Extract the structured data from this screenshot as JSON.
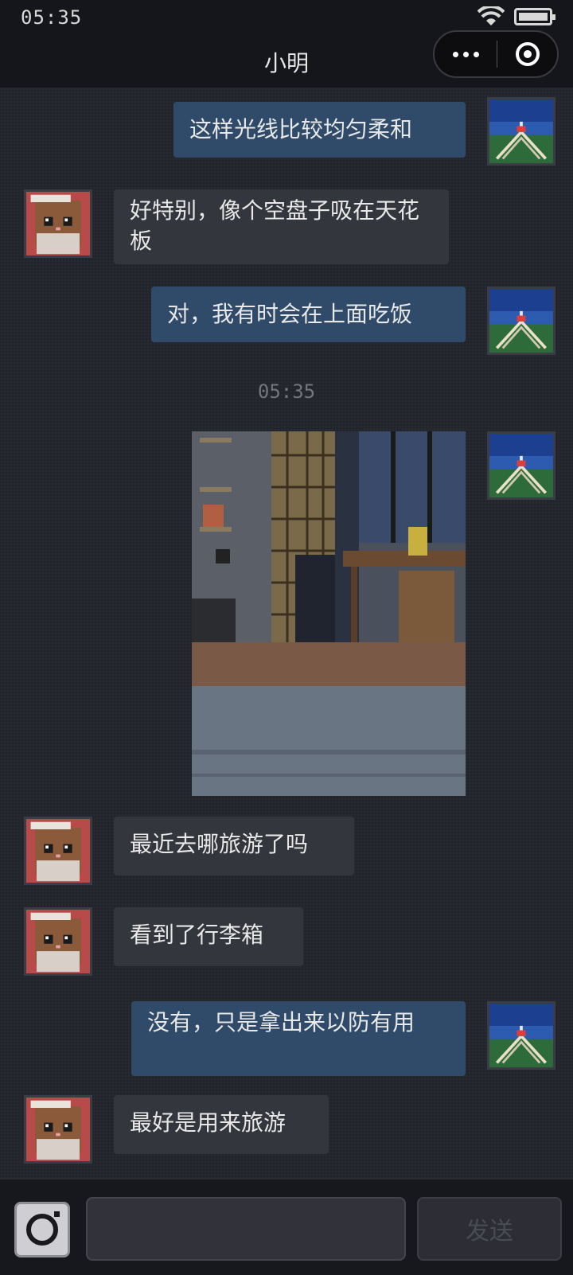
{
  "status_bar": {
    "time": "05:35",
    "wifi_icon": "wifi-icon",
    "battery_icon": "battery-icon"
  },
  "header": {
    "title": "小明",
    "more_icon": "more-dots-icon",
    "close_icon": "target-icon"
  },
  "messages": [
    {
      "from": "me",
      "text": "这样光线比较均匀柔和"
    },
    {
      "from": "other",
      "text": "好特别，像个空盘子吸在天花板"
    },
    {
      "from": "me",
      "text": "对，我有时会在上面吃饭"
    },
    {
      "type": "time",
      "text": "05:35"
    },
    {
      "from": "me",
      "type": "image",
      "description_icon": "photo-bedroom"
    },
    {
      "from": "other",
      "text": "最近去哪旅游了吗"
    },
    {
      "from": "other",
      "text": "看到了行李箱"
    },
    {
      "from": "me",
      "text": "没有，只是拿出来以防有用"
    },
    {
      "from": "other",
      "text": "最好是用来旅游"
    }
  ],
  "input_bar": {
    "camera_icon": "camera-icon",
    "send_label": "发送",
    "input_value": ""
  },
  "colors": {
    "my_bubble": "#2f4b69",
    "other_bubble": "#34363d",
    "background": "#23252c"
  }
}
